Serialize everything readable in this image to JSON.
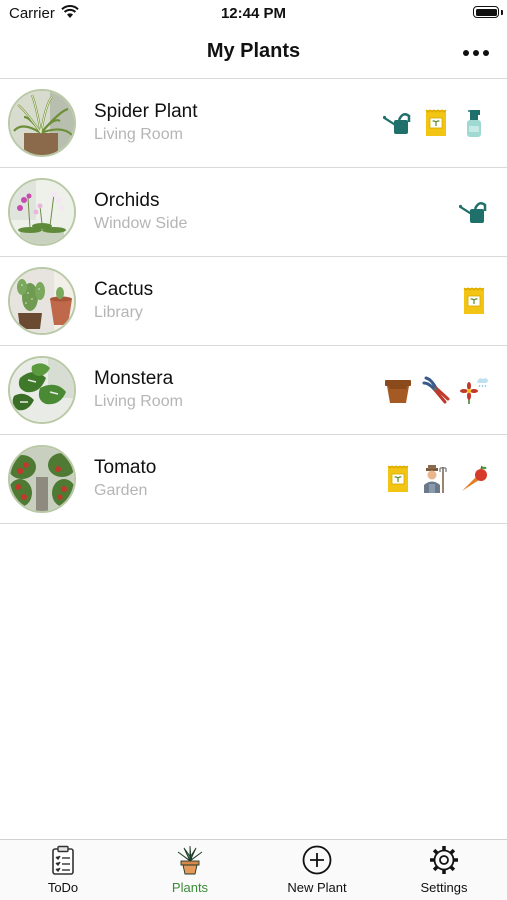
{
  "status_bar": {
    "carrier": "Carrier",
    "time": "12:44 PM"
  },
  "nav": {
    "title": "My Plants"
  },
  "plants": [
    {
      "name": "Spider Plant",
      "location": "Living Room",
      "icons": [
        "watering-can-icon",
        "seed-packet-icon",
        "spray-bottle-icon"
      ]
    },
    {
      "name": "Orchids",
      "location": "Window Side",
      "icons": [
        "watering-can-icon"
      ]
    },
    {
      "name": "Cactus",
      "location": "Library",
      "icons": [
        "seed-packet-icon"
      ]
    },
    {
      "name": "Monstera",
      "location": "Living Room",
      "icons": [
        "flower-pot-icon",
        "pruning-shears-icon",
        "flower-weather-icon"
      ]
    },
    {
      "name": "Tomato",
      "location": "Garden",
      "icons": [
        "seed-packet-icon",
        "gardener-icon",
        "harvest-icon"
      ]
    }
  ],
  "tabs": [
    {
      "label": "ToDo",
      "icon": "clipboard-icon",
      "active": false
    },
    {
      "label": "Plants",
      "icon": "potted-plant-icon",
      "active": true
    },
    {
      "label": "New Plant",
      "icon": "plus-circle-icon",
      "active": false
    },
    {
      "label": "Settings",
      "icon": "gear-icon",
      "active": false
    }
  ],
  "colors": {
    "active_tab": "#3a8a3a",
    "watering_can": "#1f6f6a",
    "seed_packet": "#f2c413",
    "spray_bottle": "#9fd9d2",
    "avatar_ring": "#b9c9a6"
  }
}
